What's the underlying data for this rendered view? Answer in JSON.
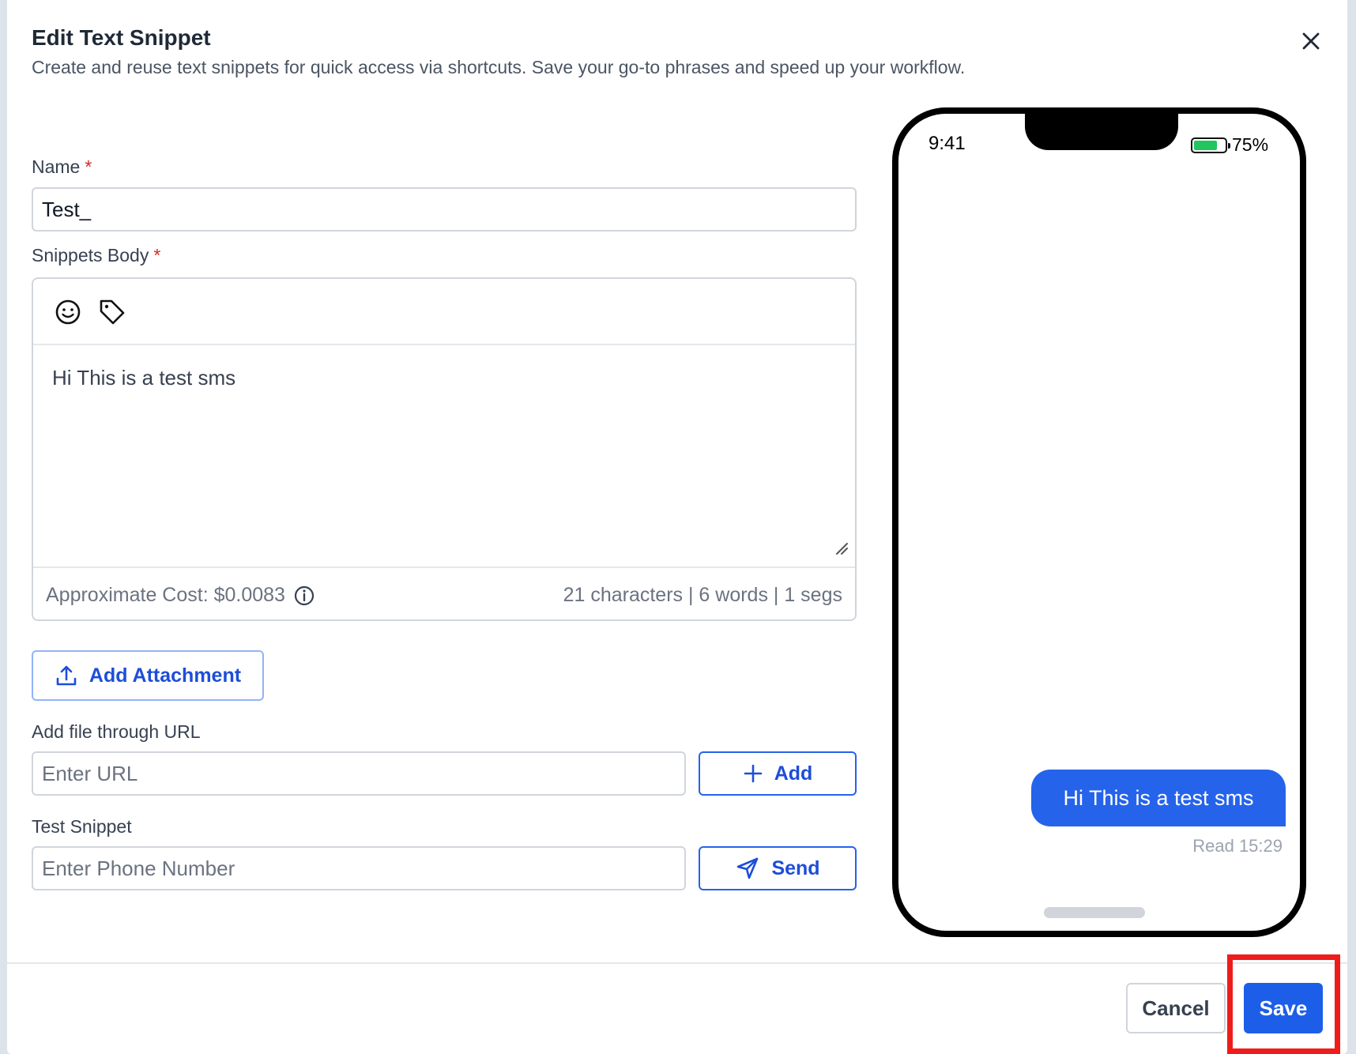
{
  "modal": {
    "title": "Edit Text Snippet",
    "subtitle": "Create and reuse text snippets for quick access via shortcuts. Save your go-to phrases and speed up your workflow."
  },
  "form": {
    "name_label": "Name",
    "name_value": "Test_",
    "required_mark": "*",
    "body_label": "Snippets Body",
    "body_text": "Hi This is a test sms",
    "cost_text": "Approximate Cost: $0.0083",
    "counts_text": "21 characters | 6 words | 1 segs",
    "attachment_button": "Add Attachment",
    "url_label": "Add file through URL",
    "url_placeholder": "Enter URL",
    "add_button": "Add",
    "test_label": "Test Snippet",
    "phone_placeholder": "Enter Phone Number",
    "send_button": "Send"
  },
  "preview": {
    "time": "9:41",
    "battery_percent": "75%",
    "battery_level": 0.75,
    "message": "Hi This is a test sms",
    "read_receipt": "Read 15:29"
  },
  "footer": {
    "cancel_button": "Cancel",
    "save_button": "Save"
  },
  "icons": {
    "close": "close-icon",
    "emoji": "emoji-icon",
    "tag": "tag-icon",
    "info": "info-icon",
    "upload": "upload-icon",
    "plus": "plus-icon",
    "send": "send-icon"
  },
  "colors": {
    "primary": "#1d5ee8",
    "bubble": "#2563eb",
    "required": "#dc2626",
    "battery": "#22c55e",
    "highlight": "#ef1c1c"
  }
}
